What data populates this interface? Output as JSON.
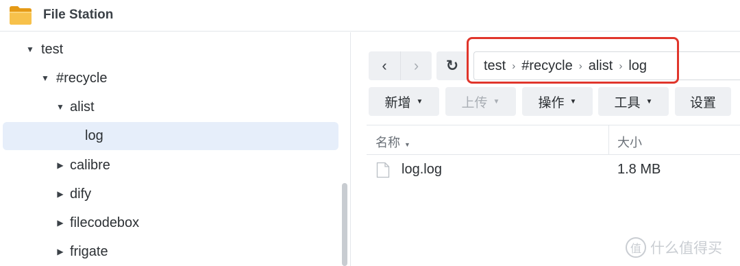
{
  "app": {
    "title": "File Station",
    "icon": "folder-icon",
    "accent": "#f5b63a"
  },
  "sidebar": {
    "tree": [
      {
        "label": "test",
        "expanded": true,
        "depth": 1
      },
      {
        "label": "#recycle",
        "expanded": true,
        "depth": 2
      },
      {
        "label": "alist",
        "expanded": true,
        "depth": 3
      },
      {
        "label": "log",
        "selected": true,
        "depth": 4
      },
      {
        "label": "calibre",
        "expanded": false,
        "depth": 3
      },
      {
        "label": "dify",
        "expanded": false,
        "depth": 3
      },
      {
        "label": "filecodebox",
        "expanded": false,
        "depth": 3
      },
      {
        "label": "frigate",
        "expanded": false,
        "depth": 3
      }
    ]
  },
  "nav": {
    "back_icon": "chevron-left-icon",
    "forward_icon": "chevron-right-icon",
    "refresh_icon": "refresh-icon",
    "back_label": "‹",
    "forward_label": "›",
    "refresh_label": "↻"
  },
  "path": {
    "crumbs": [
      "test",
      "#recycle",
      "alist",
      "log"
    ],
    "separator": "›",
    "highlight_color": "#e0352b"
  },
  "toolbar": {
    "create": "新增",
    "upload": "上传",
    "action": "操作",
    "tools": "工具",
    "settings": "设置"
  },
  "list": {
    "columns": {
      "name": "名称",
      "size": "大小"
    },
    "rows": [
      {
        "name": "log.log",
        "size": "1.8 MB",
        "icon": "file-icon"
      }
    ]
  },
  "watermark": {
    "badge": "值",
    "text": "什么值得买"
  }
}
